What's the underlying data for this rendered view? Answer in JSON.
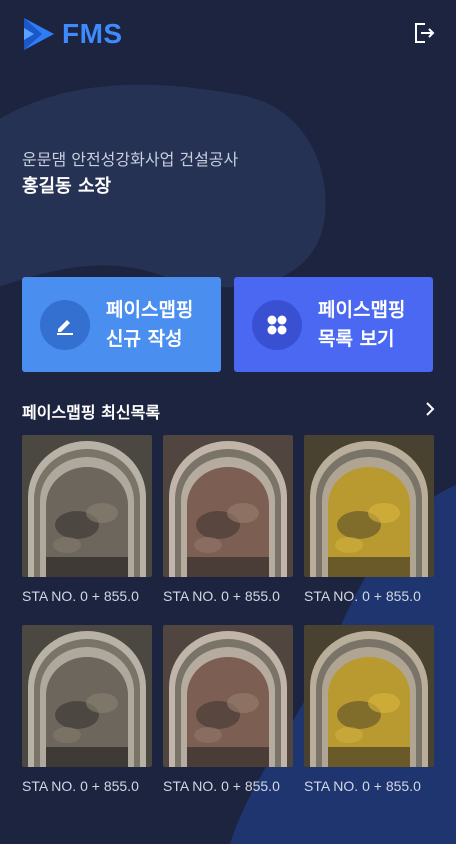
{
  "app": {
    "logo_text": "FMS",
    "brand_color": "#3d8bff",
    "logout_icon": "logout-icon"
  },
  "site": {
    "project_name": "운문댐 안전성강화사업 건설공사",
    "manager": "홍길동 소장"
  },
  "actions": [
    {
      "label": "페이스맵핑\n신규 작성",
      "icon": "pencil-icon",
      "color": "#4a8ef0"
    },
    {
      "label": "페이스맵핑\n목록 보기",
      "icon": "grid-icon",
      "color": "#4a68f2"
    }
  ],
  "recent": {
    "title": "페이스맵핑 최신목록",
    "more_icon": "chevron-right-icon",
    "items": [
      {
        "caption": "STA NO. 0 + 855.0",
        "tone": "gray"
      },
      {
        "caption": "STA NO. 0 + 855.0",
        "tone": "red"
      },
      {
        "caption": "STA NO. 0 + 855.0",
        "tone": "yellow"
      },
      {
        "caption": "STA NO. 0 + 855.0",
        "tone": "gray"
      },
      {
        "caption": "STA NO. 0 + 855.0",
        "tone": "red"
      },
      {
        "caption": "STA NO. 0 + 855.0",
        "tone": "yellow"
      }
    ]
  }
}
